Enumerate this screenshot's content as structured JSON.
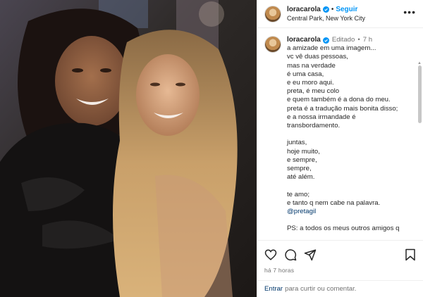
{
  "post": {
    "username": "loracarola",
    "follow_label": "Seguir",
    "separator": "•",
    "location": "Central Park, New York City"
  },
  "caption": {
    "username": "loracarola",
    "edited_label": "Editado",
    "separator": "•",
    "time": "7 h",
    "lines": [
      "a amizade em uma imagem...",
      "vc vê duas pessoas,",
      "mas na verdade",
      "é uma casa,",
      "e eu moro aqui.",
      "preta, é meu colo",
      "e quem também é a dona do meu.",
      "preta é a tradução mais bonita disso;",
      "e a nossa irmandade é",
      "transbordamento.",
      "",
      "juntas,",
      "hoje muito,",
      "e sempre,",
      "sempre,",
      "até além.",
      "",
      "te amo;",
      "e tanto q nem cabe na palavra."
    ],
    "mention": "@pretagil",
    "cut_line": "PS: a todos os meus outros amigos q"
  },
  "actions": {
    "time_ago": "há 7 horas",
    "login_link": "Entrar",
    "login_text": "para curtir ou comentar."
  },
  "icons": [
    "verified-badge-icon",
    "more-options-icon",
    "heart-icon",
    "comment-icon",
    "share-icon",
    "bookmark-icon"
  ],
  "colors": {
    "link_blue": "#0095f6",
    "verified_blue": "#0095f6",
    "mention_blue": "#00376b",
    "meta_gray": "#737373"
  }
}
